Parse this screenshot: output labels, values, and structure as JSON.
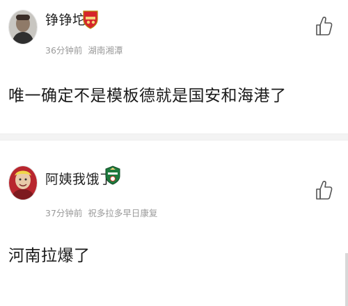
{
  "comments": [
    {
      "username": "铮铮坨",
      "time": "36分钟前",
      "location": "湖南湘潭",
      "text": "唯一确定不是模板德就是国安和海港了",
      "avatar_icon": "user-avatar-photo",
      "badge_icon": "arsenal-crest-icon",
      "badge_color": "#d6242b"
    },
    {
      "username": "阿姨我饿了",
      "time": "37分钟前",
      "location": "祝多拉多早日康复",
      "text": "河南拉爆了",
      "avatar_icon": "user-avatar-photo",
      "badge_icon": "club-crest-icon",
      "badge_color": "#1e7a3e"
    }
  ],
  "like_icon": "thumbs-up-icon"
}
